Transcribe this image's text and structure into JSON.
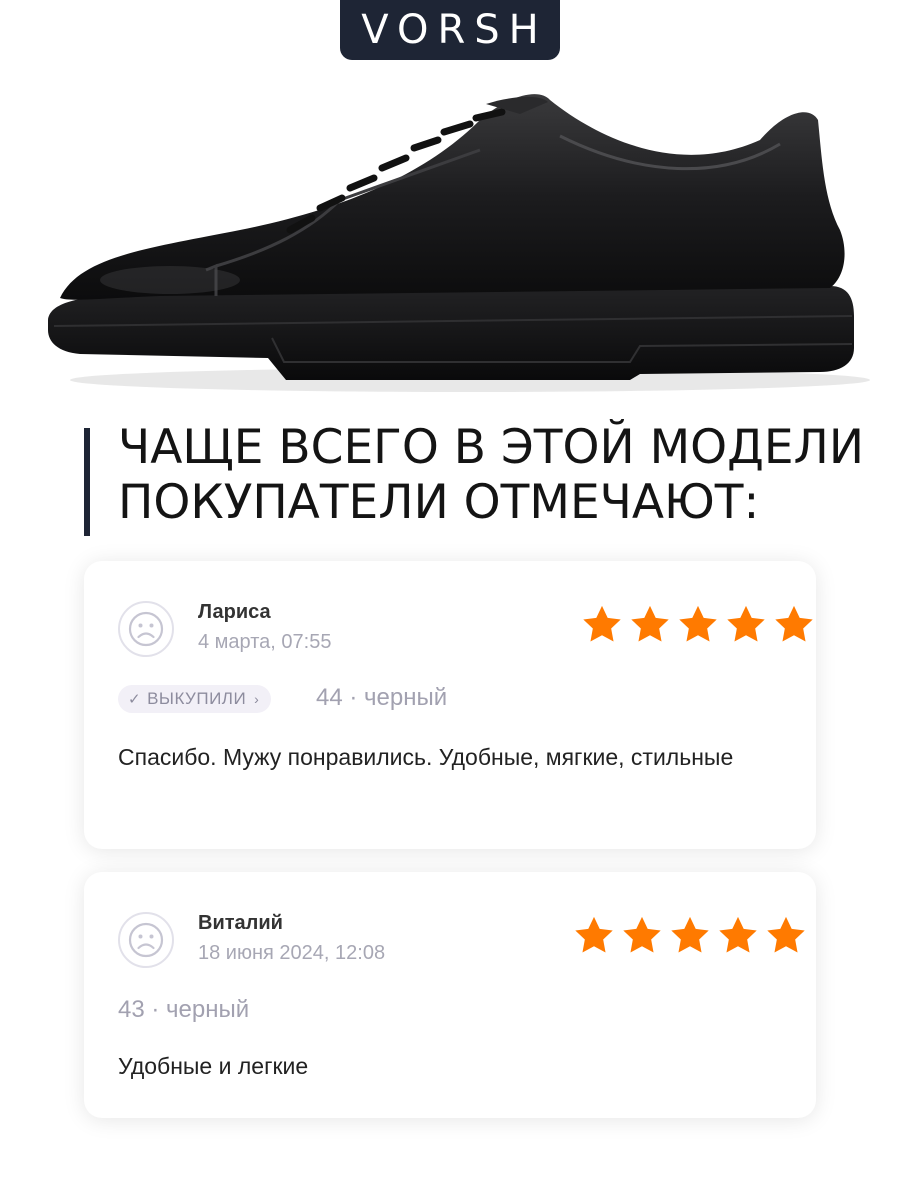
{
  "brand": {
    "name": "VORSH"
  },
  "headline": {
    "line1": "ЧАЩЕ ВСЕГО В ЭТОЙ МОДЕЛИ",
    "line2": "ПОКУПАТЕЛИ ОТМЕЧАЮТ:"
  },
  "reviews": [
    {
      "name": "Лариса",
      "date": "4 марта, 07:55",
      "rating": 5,
      "badge": {
        "tick": "✓",
        "label": "ВЫКУПИЛИ",
        "chevron": "›"
      },
      "variant": "44 · черный",
      "text": "Спасибо. Мужу понравились. Удобные, мягкие, стильные"
    },
    {
      "name": "Виталий",
      "date": "18 июня 2024, 12:08",
      "rating": 5,
      "variant": "43 · черный",
      "text": "Удобные и легкие"
    }
  ],
  "colors": {
    "brand_bg": "#1e2535",
    "star": "#ff7a00",
    "muted": "#a7a7b4",
    "badge_bg": "#f2f0f7"
  },
  "icons": {
    "avatar": "sad-face-icon",
    "star": "star-icon"
  }
}
